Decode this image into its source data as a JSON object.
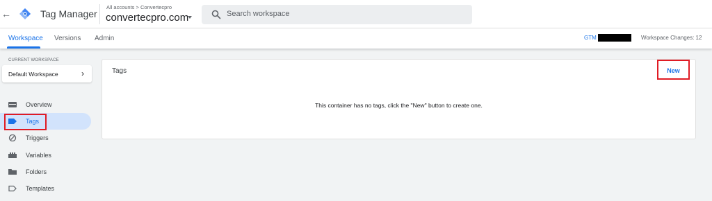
{
  "header": {
    "app_title": "Tag Manager",
    "breadcrumb": "All accounts > Convertecpro",
    "container_name": "convertecpro.com",
    "search_placeholder": "Search workspace"
  },
  "tabs": [
    {
      "label": "Workspace",
      "active": true
    },
    {
      "label": "Versions",
      "active": false
    },
    {
      "label": "Admin",
      "active": false
    }
  ],
  "gtm_id_prefix": "GTM",
  "workspace_changes": "Workspace Changes: 12",
  "sidebar": {
    "current_workspace_label": "CURRENT WORKSPACE",
    "workspace_name": "Default Workspace",
    "items": [
      {
        "label": "Overview",
        "icon": "overview-icon"
      },
      {
        "label": "Tags",
        "icon": "tag-icon",
        "active": true
      },
      {
        "label": "Triggers",
        "icon": "trigger-icon"
      },
      {
        "label": "Variables",
        "icon": "variables-icon"
      },
      {
        "label": "Folders",
        "icon": "folder-icon"
      },
      {
        "label": "Templates",
        "icon": "template-icon"
      }
    ]
  },
  "main": {
    "card_title": "Tags",
    "new_button": "New",
    "empty_message": "This container has no tags, click the \"New\" button to create one."
  },
  "colors": {
    "accent": "#1a73e8",
    "highlight": "#e01b24",
    "active_nav_bg": "#d2e3fc"
  }
}
